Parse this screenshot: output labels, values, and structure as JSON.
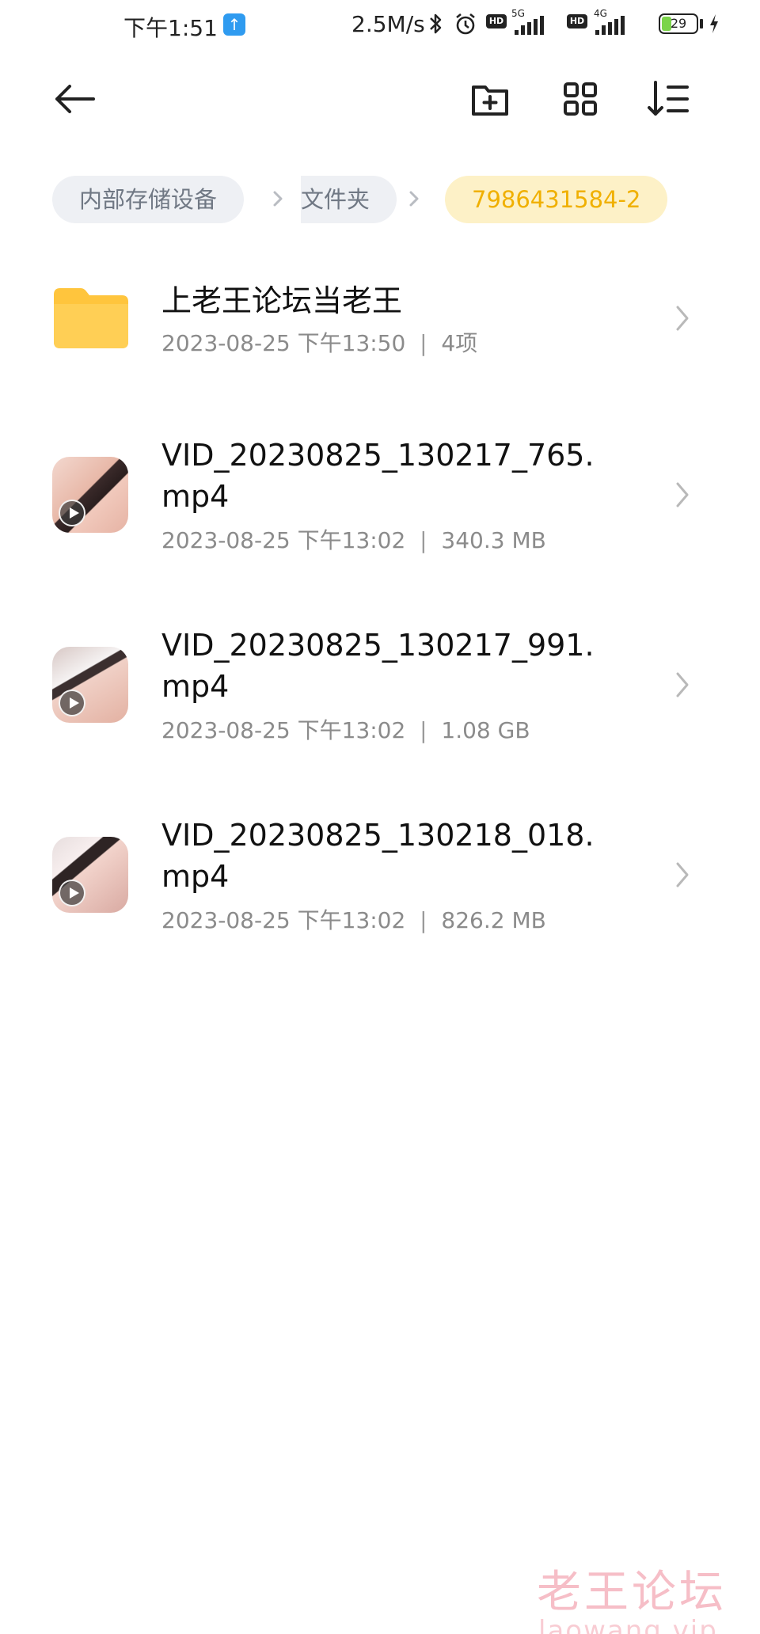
{
  "status_bar": {
    "time": "下午1:51",
    "upload_icon": "arrow-up-icon",
    "net_speed": "2.5M/s",
    "net1_label": "5G",
    "net2_label": "4G",
    "hd_label": "HD",
    "battery": "29",
    "battery_level": 0.29
  },
  "toolbar": {
    "back_icon": "back-arrow-icon",
    "new_folder_icon": "new-folder-icon",
    "grid_icon": "grid-view-icon",
    "sort_icon": "sort-icon"
  },
  "breadcrumb": [
    {
      "label": "内部存储设备"
    },
    {
      "label": "文件夹"
    },
    {
      "label": "7986431584-2"
    }
  ],
  "files": [
    {
      "type": "folder",
      "name": "上老王论坛当老王",
      "date": "2023-08-25 下午13:50",
      "detail": "4项"
    },
    {
      "type": "video",
      "name": "VID_20230825_130217_765.mp4",
      "date": "2023-08-25 下午13:02",
      "detail": "340.3 MB"
    },
    {
      "type": "video",
      "name": "VID_20230825_130217_991.mp4",
      "date": "2023-08-25 下午13:02",
      "detail": "1.08 GB"
    },
    {
      "type": "video",
      "name": "VID_20230825_130218_018.mp4",
      "date": "2023-08-25 下午13:02",
      "detail": "826.2 MB"
    }
  ],
  "watermark": {
    "text": "老王论坛",
    "sub": "laowang.vip"
  },
  "colors": {
    "folder": "#ffc53d",
    "breadcrumb_active_bg": "#fdf1c7",
    "breadcrumb_active_text": "#f0b000",
    "breadcrumb_bg": "#eef0f4",
    "meta_text": "#8b8b8b"
  }
}
